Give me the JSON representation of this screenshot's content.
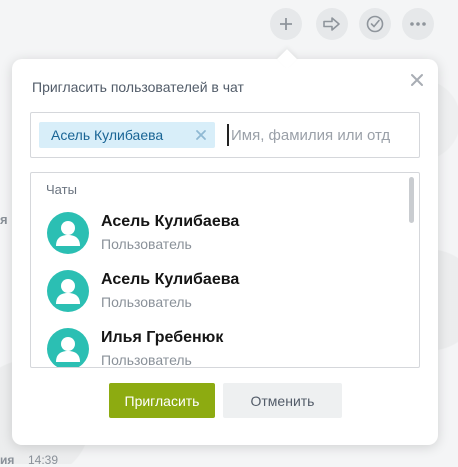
{
  "toolbar": {
    "buttons": [
      {
        "icon": "plus-icon"
      },
      {
        "icon": "forward-arrow-icon"
      },
      {
        "icon": "check-circle-icon"
      },
      {
        "icon": "more-dots-icon"
      }
    ]
  },
  "background": {
    "left_fragment": "я",
    "bottom_fragment": "ия",
    "time": "14:39"
  },
  "popup": {
    "title": "Пригласить пользователей в чат",
    "selected_chip": "Асель Кулибаева",
    "search_placeholder": "Имя, фамилия или отд",
    "search_value": "",
    "list": {
      "section_header": "Чаты",
      "items": [
        {
          "name": "Асель Кулибаева",
          "subtitle": "Пользователь"
        },
        {
          "name": "Асель Кулибаева",
          "subtitle": "Пользователь"
        },
        {
          "name": "Илья Гребенюк",
          "subtitle": "Пользователь"
        }
      ]
    },
    "invite_label": "Пригласить",
    "cancel_label": "Отменить"
  },
  "colors": {
    "accent_green": "#8dab11",
    "avatar_teal": "#2bbfb3",
    "chip_bg": "#d8eef9",
    "chip_text": "#1a6595"
  }
}
